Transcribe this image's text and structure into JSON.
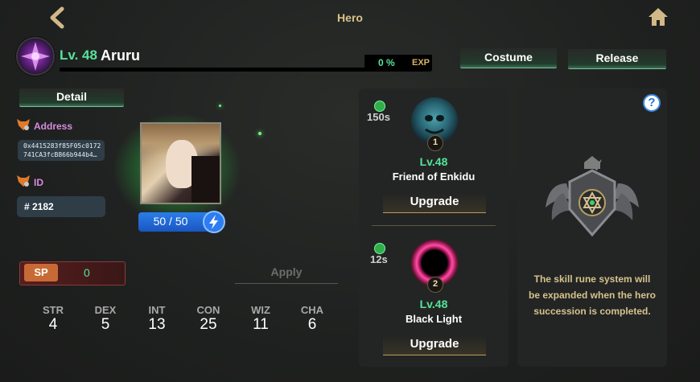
{
  "header": {
    "title": "Hero"
  },
  "hero": {
    "level": "Lv. 48",
    "name": "Aruru",
    "exp_percent": "0 %",
    "exp_label": "EXP",
    "exp_progress": 0
  },
  "actions": {
    "costume": "Costume",
    "release": "Release",
    "detail": "Detail",
    "apply": "Apply"
  },
  "info": {
    "address_label": "Address",
    "address_line_1": "0x4415283f85F05c0172",
    "address_line_2": "741CA3fcB866b944b4…",
    "id_label": "ID",
    "id_value": "# 2182"
  },
  "stamina": {
    "value": "50 / 50"
  },
  "sp": {
    "label": "SP",
    "value": "0"
  },
  "stats": [
    {
      "name": "STR",
      "value": "4"
    },
    {
      "name": "DEX",
      "value": "5"
    },
    {
      "name": "INT",
      "value": "13"
    },
    {
      "name": "CON",
      "value": "25"
    },
    {
      "name": "WIZ",
      "value": "11"
    },
    {
      "name": "CHA",
      "value": "6"
    }
  ],
  "skills": [
    {
      "cooldown": "150s",
      "badge": "1",
      "level": "Lv.48",
      "name": "Friend of Enkidu",
      "button": "Upgrade"
    },
    {
      "cooldown": "12s",
      "badge": "2",
      "level": "Lv.48",
      "name": "Black Light",
      "button": "Upgrade"
    }
  ],
  "rune": {
    "help": "?",
    "message_line_1": "The skill rune system will",
    "message_line_2": "be expanded when the hero",
    "message_line_3": "succession is completed."
  },
  "icons": {
    "back": "back-arrow-icon",
    "home": "home-icon",
    "address": "fox-icon",
    "id": "fox-icon",
    "stamina": "lightning-icon",
    "cooldown": "timer-icon",
    "help": "question-icon"
  },
  "colors": {
    "accent_green": "#56e39a",
    "gold": "#d6b265",
    "pink_label": "#d98ae0",
    "stamina_blue": "#2a7de8"
  }
}
